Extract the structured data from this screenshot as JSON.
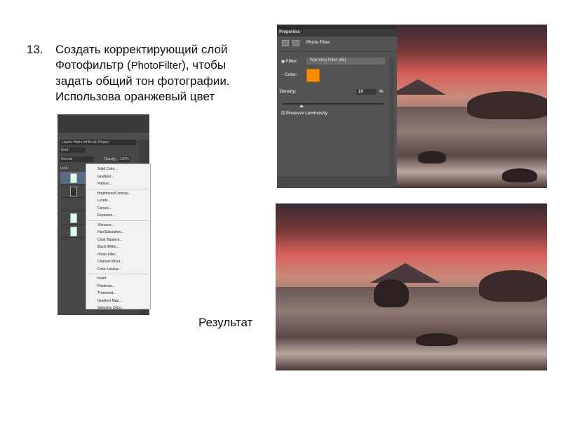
{
  "step": {
    "number": "13.",
    "line1": "Создать корректирующий слой",
    "line2a": "Фотофильтр (",
    "line2b": "PhotoFilter",
    "line2c": "), чтобы",
    "line3": "задать общий тон фотографии.",
    "line4": "Использова оранжевый цвет"
  },
  "result_label": "Результат",
  "layers_panel": {
    "tabs": "Layers  Histor  Inf  Brush  Proper",
    "kind": "Kind",
    "blend": "Normal",
    "opacity_label": "Opacity:",
    "opacity": "100%",
    "lock": "Lock:",
    "menu": [
      [
        "Solid Color...",
        "Gradient...",
        "Pattern..."
      ],
      [
        "Brightness/Contrast...",
        "Levels...",
        "Curves...",
        "Exposure..."
      ],
      [
        "Vibrance...",
        "Hue/Saturation...",
        "Color Balance...",
        "Black  White...",
        "Photo Filter...",
        "Channel Mixer...",
        "Color Lookup..."
      ],
      [
        "Invert",
        "Posterize...",
        "Threshold...",
        "Gradient Map...",
        "Selective Color..."
      ]
    ]
  },
  "properties_panel": {
    "tab": "Properties",
    "title": "Photo Filter",
    "filter_label": "Filter:",
    "filter_value": "Warming Filter (85)",
    "color_label": "Color:",
    "color": "#ff8c00",
    "density_label": "Density:",
    "density": "19",
    "percent": "%",
    "preserve": "Preserve Luminosity",
    "density_fraction": 0.19
  }
}
